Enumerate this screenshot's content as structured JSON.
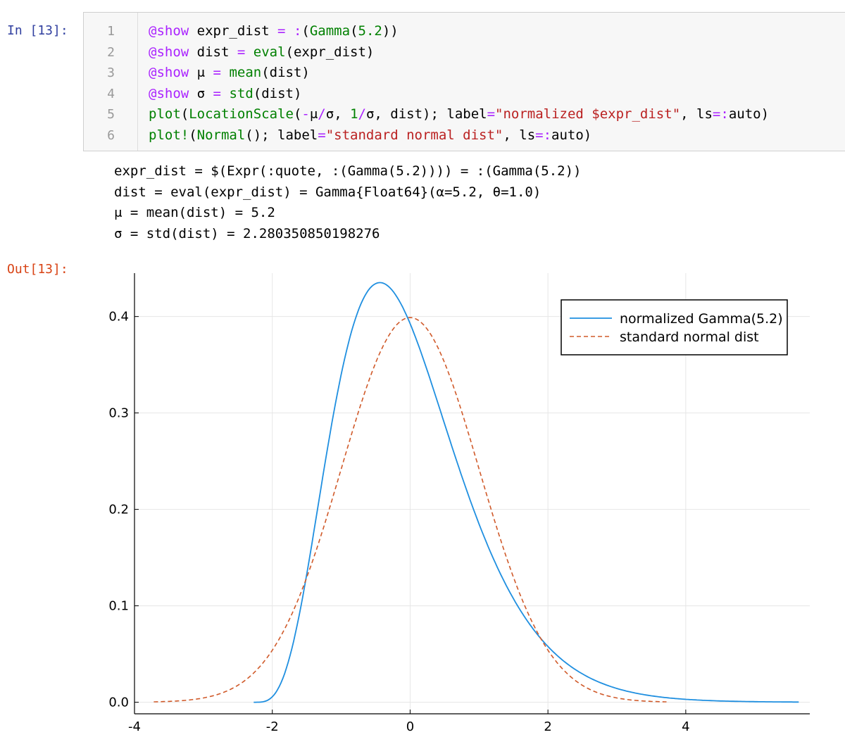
{
  "cell": {
    "in_prompt": "In [13]:",
    "out_prompt": "Out[13]:",
    "lines": [
      {
        "no": "1",
        "tokens": [
          [
            "macro",
            "@show"
          ],
          [
            "plain",
            " expr_dist "
          ],
          [
            "op",
            "="
          ],
          [
            "plain",
            " "
          ],
          [
            "op",
            ":"
          ],
          [
            "plain",
            "("
          ],
          [
            "fn",
            "Gamma"
          ],
          [
            "plain",
            "("
          ],
          [
            "num",
            "5.2"
          ],
          [
            "plain",
            "))"
          ]
        ]
      },
      {
        "no": "2",
        "tokens": [
          [
            "macro",
            "@show"
          ],
          [
            "plain",
            " dist "
          ],
          [
            "op",
            "="
          ],
          [
            "plain",
            " "
          ],
          [
            "fn",
            "eval"
          ],
          [
            "plain",
            "(expr_dist)"
          ]
        ]
      },
      {
        "no": "3",
        "tokens": [
          [
            "macro",
            "@show"
          ],
          [
            "plain",
            " μ "
          ],
          [
            "op",
            "="
          ],
          [
            "plain",
            " "
          ],
          [
            "fn",
            "mean"
          ],
          [
            "plain",
            "(dist)"
          ]
        ]
      },
      {
        "no": "4",
        "tokens": [
          [
            "macro",
            "@show"
          ],
          [
            "plain",
            " σ "
          ],
          [
            "op",
            "="
          ],
          [
            "plain",
            " "
          ],
          [
            "fn",
            "std"
          ],
          [
            "plain",
            "(dist)"
          ]
        ]
      },
      {
        "no": "5",
        "tokens": [
          [
            "fn",
            "plot"
          ],
          [
            "plain",
            "("
          ],
          [
            "fn",
            "LocationScale"
          ],
          [
            "plain",
            "("
          ],
          [
            "op",
            "-"
          ],
          [
            "plain",
            "μ"
          ],
          [
            "op",
            "/"
          ],
          [
            "plain",
            "σ, "
          ],
          [
            "num",
            "1"
          ],
          [
            "op",
            "/"
          ],
          [
            "plain",
            "σ, dist); label"
          ],
          [
            "op",
            "="
          ],
          [
            "str",
            "\"normalized $expr_dist\""
          ],
          [
            "plain",
            ", ls"
          ],
          [
            "op",
            "="
          ],
          [
            "op",
            ":"
          ],
          [
            "plain",
            "auto)"
          ]
        ]
      },
      {
        "no": "6",
        "tokens": [
          [
            "fn",
            "plot!"
          ],
          [
            "plain",
            "("
          ],
          [
            "fn",
            "Normal"
          ],
          [
            "plain",
            "(); label"
          ],
          [
            "op",
            "="
          ],
          [
            "str",
            "\"standard normal dist\""
          ],
          [
            "plain",
            ", ls"
          ],
          [
            "op",
            "="
          ],
          [
            "op",
            ":"
          ],
          [
            "plain",
            "auto)"
          ]
        ]
      }
    ],
    "stdout": [
      "expr_dist = $(Expr(:quote, :(Gamma(5.2)))) = :(Gamma(5.2))",
      "dist = eval(expr_dist) = Gamma{Float64}(α=5.2, θ=1.0)",
      "μ = mean(dist) = 5.2",
      "σ = std(dist) = 2.280350850198276"
    ]
  },
  "colors": {
    "gamma": "#1f8fe0",
    "normal": "#d05a2a"
  },
  "chart_data": {
    "type": "line",
    "xlim": [
      -4,
      5.8
    ],
    "ylim": [
      -0.012,
      0.445
    ],
    "xticks": [
      -4,
      -2,
      0,
      2,
      4
    ],
    "xtick_labels": [
      "-4",
      "-2",
      "0",
      "2",
      "4"
    ],
    "yticks": [
      0.0,
      0.1,
      0.2,
      0.3,
      0.4
    ],
    "ytick_labels": [
      "0.0",
      "0.1",
      "0.2",
      "0.3",
      "0.4"
    ],
    "grid": true,
    "legend_position": "top-right",
    "series": [
      {
        "name": "normalized Gamma(5.2)",
        "style": "solid",
        "x_range": [
          -2.27,
          5.64
        ],
        "mu": 5.2,
        "sigma": 2.280350850198276,
        "shape": 5.2
      },
      {
        "name": "standard normal dist",
        "style": "dashed",
        "x_range": [
          -3.72,
          3.72
        ]
      }
    ]
  }
}
